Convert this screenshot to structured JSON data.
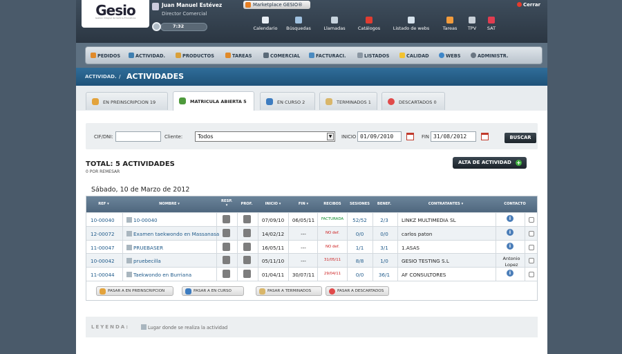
{
  "header": {
    "logo": "Gesio",
    "logo_sub": "Gestion Integral de Centros Educativos",
    "user_name": "Juan Manuel Estévez",
    "user_role": "Director Comercial",
    "clock": "7:32",
    "marketplace": "Marketplace GESIO®",
    "close": "Cerrar"
  },
  "shortcuts": [
    "Calendario",
    "Búsquedas",
    "Llamadas",
    "Catálogos",
    "Listado de webs",
    "Tareas",
    "TPV",
    "SAT"
  ],
  "menu": [
    "PEDIDOS",
    "ACTIVIDAD.",
    "PRODUCTOS",
    "TAREAS",
    "COMERCIAL",
    "FACTURACI.",
    "LISTADOS",
    "CALIDAD",
    "WEBS",
    "ADMINISTR."
  ],
  "breadcrumb": {
    "parent": "ACTIVIDAD.",
    "separator": "/",
    "current": "ACTIVIDADES"
  },
  "tabs": [
    "EN PREINSCRIPCION 19",
    "MATRICULA ABIERTA 5",
    "EN CURSO 2",
    "TERMINADOS 1",
    "DESCARTADOS 0"
  ],
  "filter": {
    "cif_label": "CIF/DNI:",
    "cif_value": "",
    "cliente_label": "Cliente:",
    "cliente_value": "Todos",
    "inicio_label": "INICIO",
    "inicio_value": "01/09/2010",
    "fin_label": "FIN",
    "fin_value": "31/08/2012",
    "buscar": "BUSCAR"
  },
  "summary": {
    "total": "TOTAL: 5 ACTIVIDADES",
    "remesar": "0 POR REMESAR",
    "alta": "ALTA DE ACTIVIDAD"
  },
  "date_heading": "Sábado, 10 de Marzo de 2012",
  "table": {
    "headers": [
      "REF",
      "NOMBRE",
      "RESP.",
      "PROF.",
      "INICIO",
      "FIN",
      "RECIBOS",
      "SESIONES",
      "BENEF.",
      "CONTRATANTES",
      "CONTACTO"
    ],
    "rows": [
      {
        "ref": "10-00040",
        "nombre": "10-00040",
        "inicio": "07/09/10",
        "fin": "06/05/11",
        "recibos": "FACTURADA",
        "sesiones": "52/52",
        "benef": "2/3",
        "contratantes": "LINKZ MULTIMEDIA SL",
        "contacto": ""
      },
      {
        "ref": "12-00072",
        "nombre": "Examen taekwondo en Massanasa",
        "inicio": "14/02/12",
        "fin": "---",
        "recibos": "NO def.",
        "sesiones": "0/0",
        "benef": "0/0",
        "contratantes": "carlos paton",
        "contacto": ""
      },
      {
        "ref": "11-00047",
        "nombre": "PRUEBASER",
        "inicio": "16/05/11",
        "fin": "---",
        "recibos": "NO def.",
        "sesiones": "1/1",
        "benef": "3/1",
        "contratantes": "1.ASAS",
        "contacto": ""
      },
      {
        "ref": "10-00042",
        "nombre": "pruebecilla",
        "inicio": "05/11/10",
        "fin": "---",
        "recibos": "31/05/11",
        "sesiones": "8/8",
        "benef": "1/0",
        "contratantes": "GESIO TESTING S.L",
        "contacto": "Antonio Lopez"
      },
      {
        "ref": "11-00044",
        "nombre": "Taekwondo en Burriana",
        "inicio": "01/04/11",
        "fin": "30/07/11",
        "recibos": "29/04/11",
        "sesiones": "0/0",
        "benef": "36/1",
        "contratantes": "AF CONSULTORES",
        "contacto": ""
      }
    ]
  },
  "actions": [
    "PASAR A EN PREINSCRIPCION",
    "PASAR A EN CURSO",
    "PASAR A TERMINADOS",
    "PASAR A DESCARTADOS"
  ],
  "legend": {
    "title": "LEYENDA:",
    "text": "Lugar donde se realiza la actividad"
  }
}
